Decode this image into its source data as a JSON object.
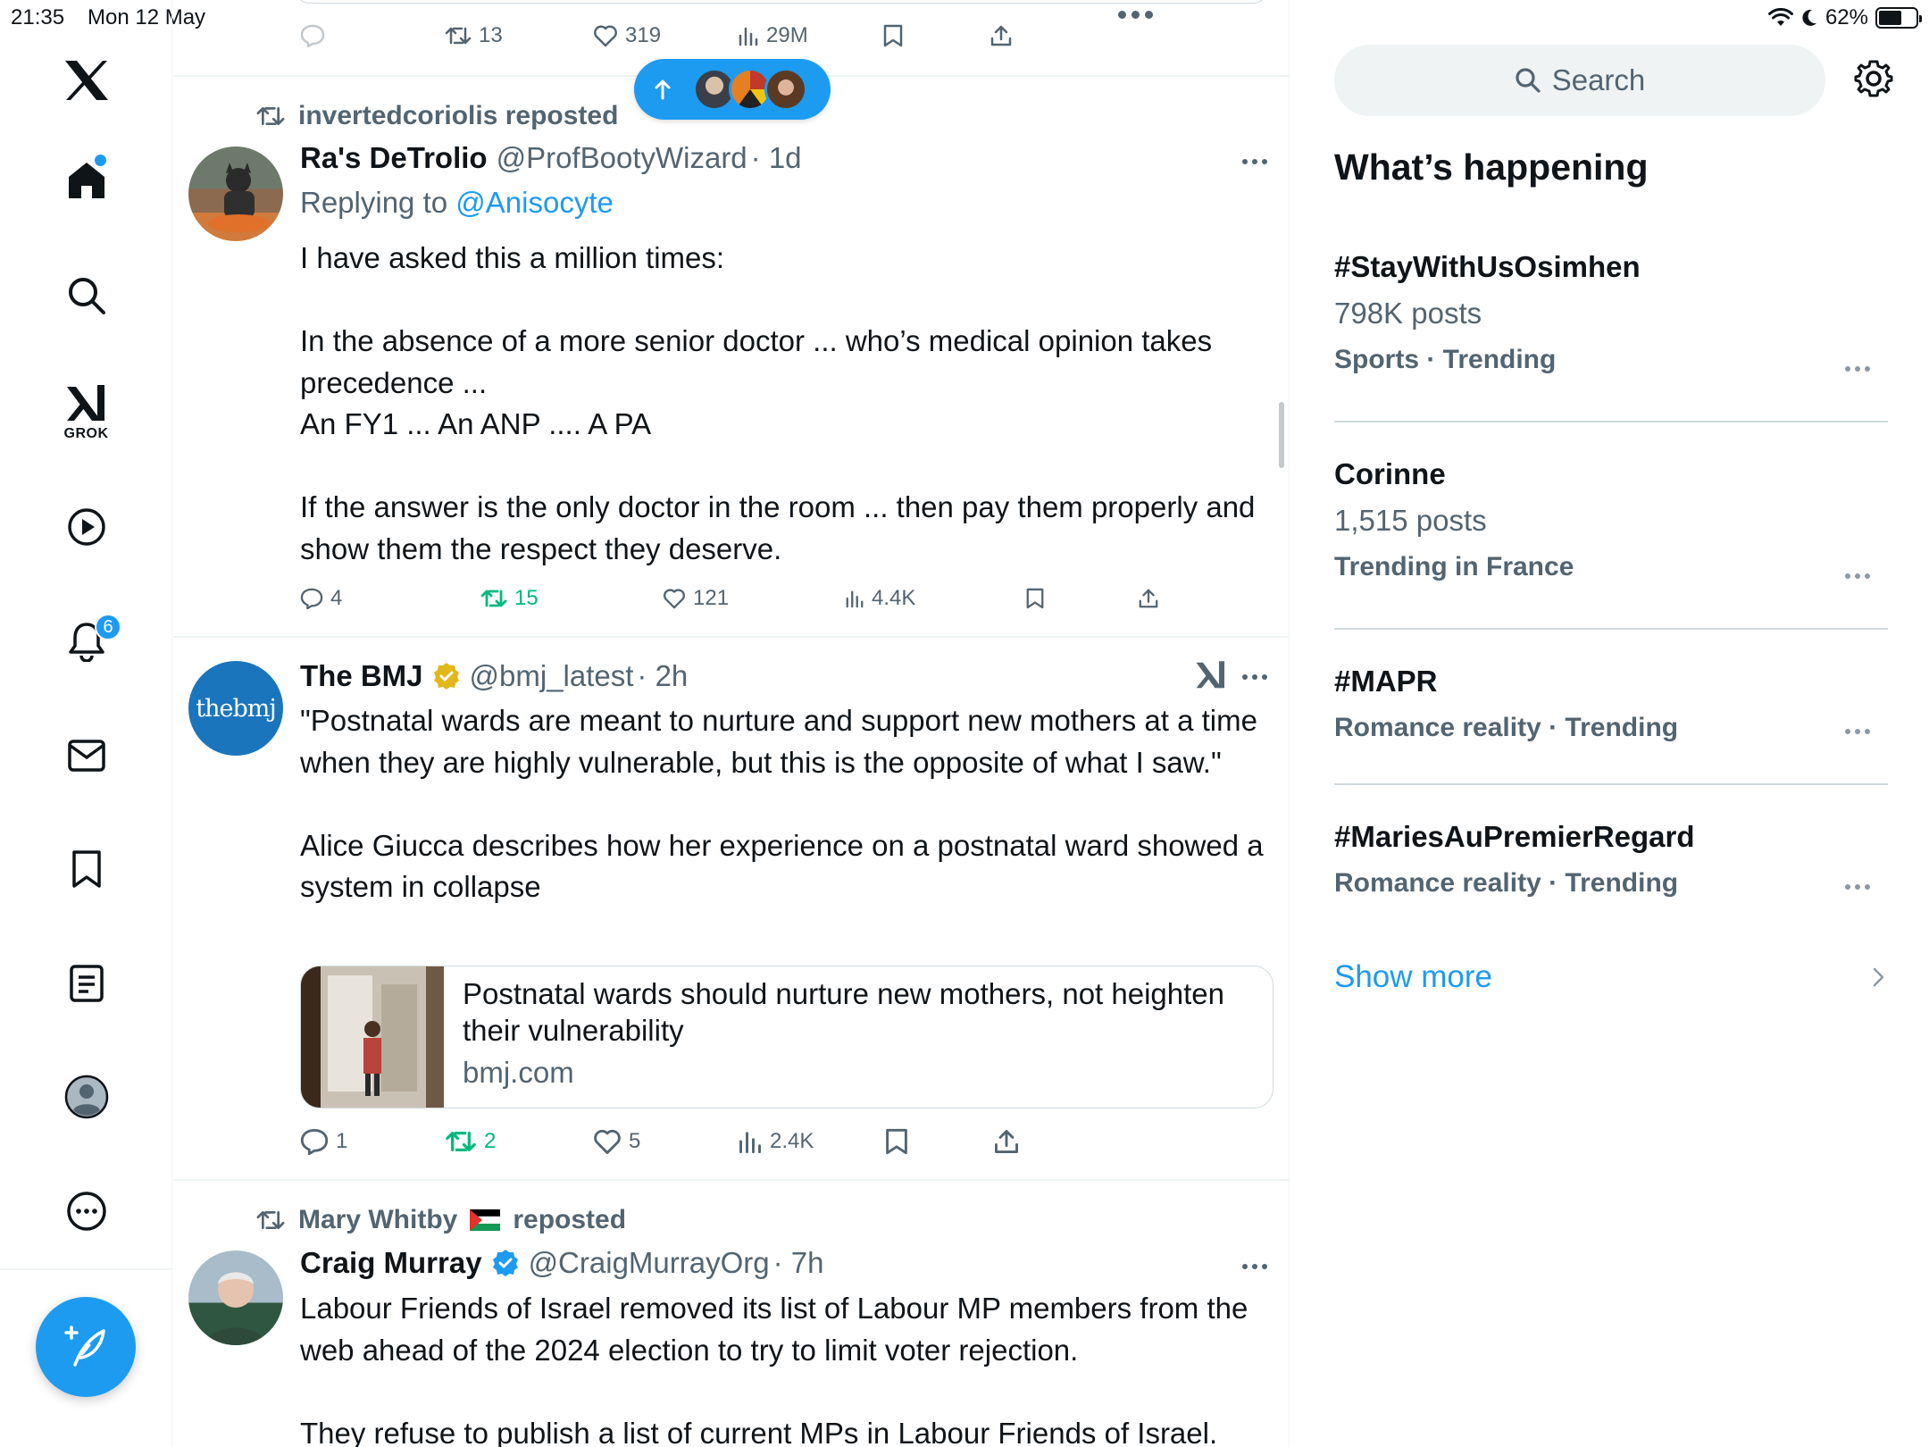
{
  "status_bar": {
    "time": "21:35",
    "date": "Mon 12 May",
    "battery": "62%",
    "battery_level": 0.62
  },
  "sidebar": {
    "logo": "x-logo-icon",
    "items": [
      {
        "name": "home",
        "icon": "home-icon",
        "has_dot": true
      },
      {
        "name": "explore",
        "icon": "search-icon"
      },
      {
        "name": "grok",
        "icon": "grok-icon",
        "label": "GROK"
      },
      {
        "name": "video",
        "icon": "play-icon"
      },
      {
        "name": "notifications",
        "icon": "bell-icon",
        "badge": "6"
      },
      {
        "name": "messages",
        "icon": "mail-icon"
      },
      {
        "name": "bookmarks",
        "icon": "bookmark-icon"
      },
      {
        "name": "lists",
        "icon": "list-icon"
      },
      {
        "name": "profile",
        "icon": "profile-icon"
      },
      {
        "name": "more",
        "icon": "more-icon"
      }
    ],
    "compose_icon": "compose-icon"
  },
  "top_post_actions": {
    "retweets": "13",
    "likes": "319",
    "views": "29M"
  },
  "new_posts_pill": {
    "icon": "arrow-up-icon"
  },
  "posts": [
    {
      "reposted_by": "invertedcoriolis reposted",
      "name": "Ra's DeTrolio",
      "handle": "@ProfBootyWizard",
      "time": "· 1d",
      "replying_prefix": "Replying to ",
      "replying_to": "@Anisocyte",
      "body": "I have asked this a million times:\n\nIn the absence of a more senior doctor ... who’s medical opinion takes precedence ...\nAn FY1 ... An ANP .... A PA\n\nIf the answer is the only doctor in the room ... then pay them properly and show them the respect they deserve.",
      "replies": "4",
      "retweets": "15",
      "likes": "121",
      "views": "4.4K"
    },
    {
      "name": "The BMJ",
      "handle": "@bmj_latest",
      "time": "· 2h",
      "avatar_text": "thebmj",
      "verified": "gold",
      "body": "\"Postnatal wards are meant to nurture and support new mothers at a time when they are highly vulnerable, but this is the opposite of what I saw.\"\n\nAlice Giucca describes how her experience on a postnatal ward showed a system in collapse",
      "link_title": "Postnatal wards should nurture new mothers, not heighten their vulnerability",
      "link_domain": "bmj.com",
      "replies": "1",
      "retweets": "2",
      "likes": "5",
      "views": "2.4K"
    },
    {
      "reposted_by_name": "Mary Whitby",
      "reposted_suffix": "reposted",
      "name": "Craig Murray",
      "handle": "@CraigMurrayOrg",
      "time": "· 7h",
      "verified": "blue",
      "body": "Labour Friends of Israel removed its list of Labour MP members from the web ahead of the 2024 election to try to limit voter rejection.\n\nThey refuse to publish a list of current MPs in Labour Friends of Israel."
    }
  ],
  "right_panel": {
    "search_placeholder": "Search",
    "section_title": "What’s happening",
    "trends": [
      {
        "name": "#StayWithUsOsimhen",
        "posts": "798K posts",
        "meta": "Sports · Trending"
      },
      {
        "name": "Corinne",
        "posts": "1,515 posts",
        "meta": "Trending in France"
      },
      {
        "name": "#MAPR",
        "meta": "Romance reality · Trending"
      },
      {
        "name": "#MariesAuPremierRegard",
        "meta": "Romance reality · Trending"
      }
    ],
    "show_more": "Show more"
  },
  "colors": {
    "accent": "#1d9bf0",
    "retweet_green": "#00ba7c",
    "secondary_text": "#536471",
    "verified_gold": "#e2b719"
  }
}
